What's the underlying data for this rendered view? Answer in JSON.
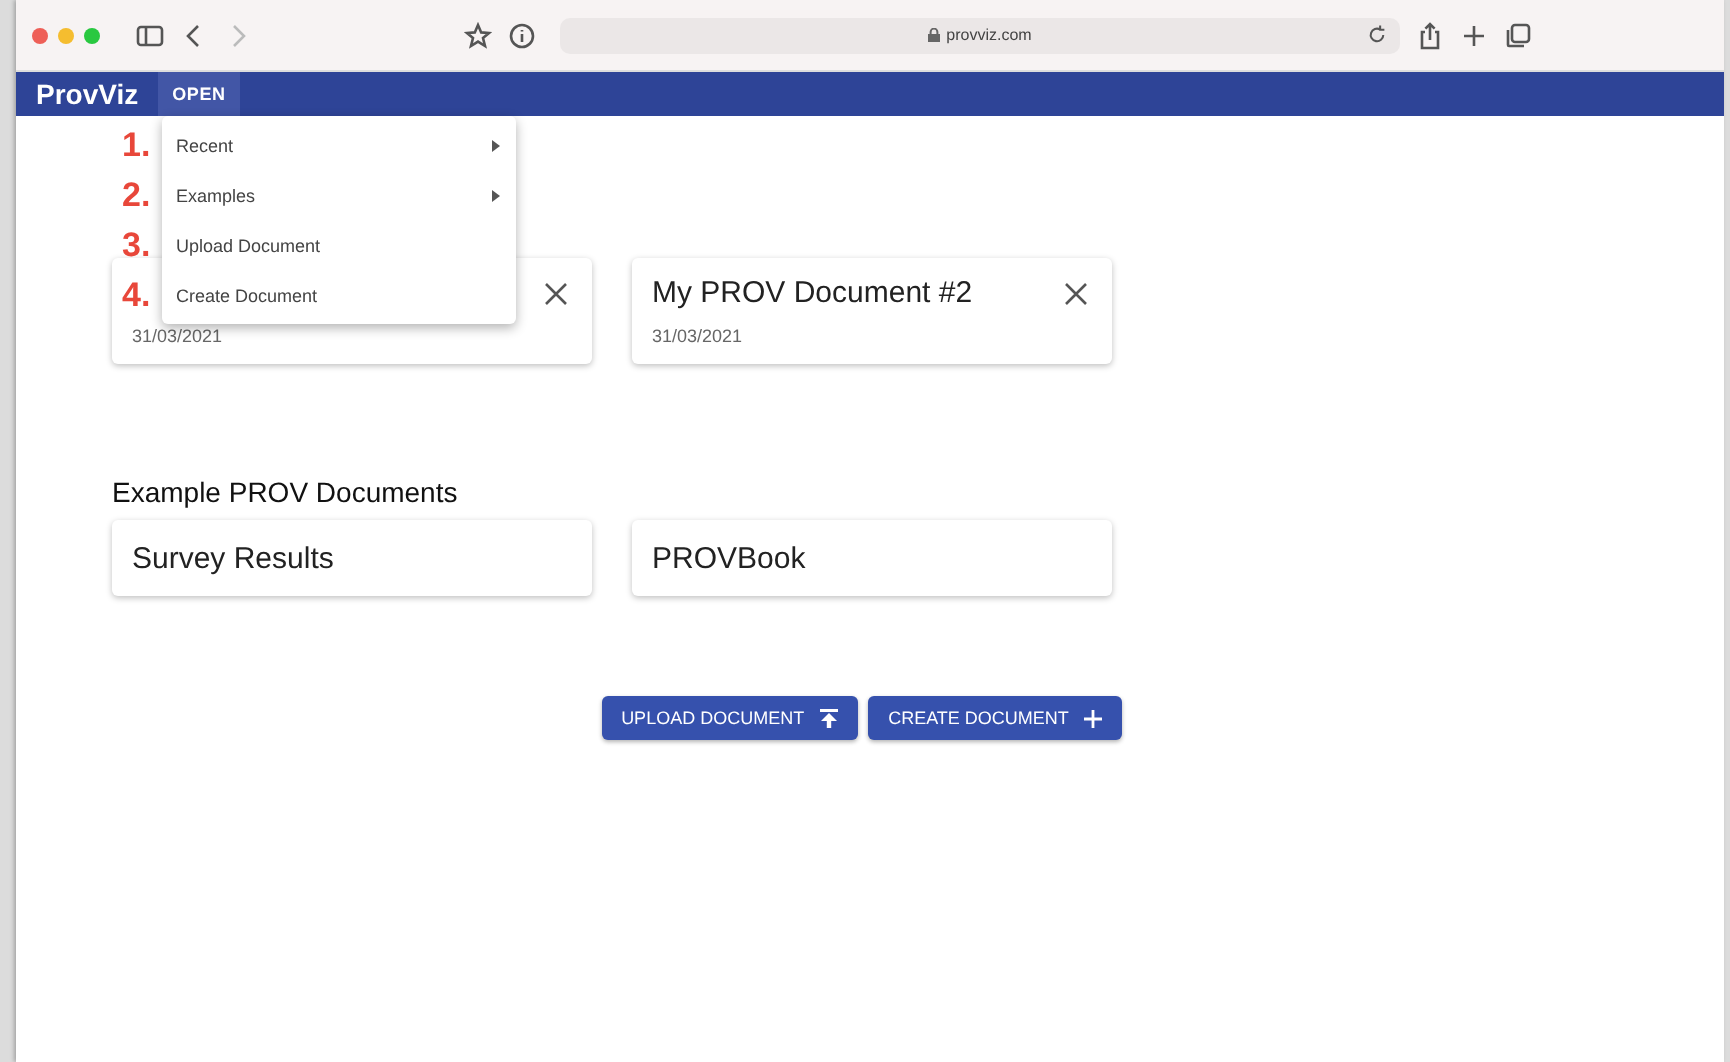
{
  "browser": {
    "url": "provviz.com"
  },
  "app_bar": {
    "title": "ProvViz",
    "menu_button": "OPEN"
  },
  "menu": [
    {
      "label": "Recent",
      "kind": "submenu"
    },
    {
      "label": "Examples",
      "kind": "submenu"
    },
    {
      "label": "Upload Document",
      "kind": "action"
    },
    {
      "label": "Create Document",
      "kind": "action"
    }
  ],
  "annotations": [
    "1.",
    "2.",
    "3.",
    "4."
  ],
  "recent_documents": [
    {
      "date": "31/03/2021"
    },
    {
      "title": "My PROV Document #2",
      "date": "31/03/2021"
    }
  ],
  "examples": {
    "heading": "Example PROV Documents",
    "items": [
      "Survey Results",
      "PROVBook"
    ]
  },
  "buttons": [
    {
      "label": "UPLOAD DOCUMENT",
      "kind": "upload"
    },
    {
      "label": "CREATE DOCUMENT",
      "kind": "create"
    }
  ]
}
